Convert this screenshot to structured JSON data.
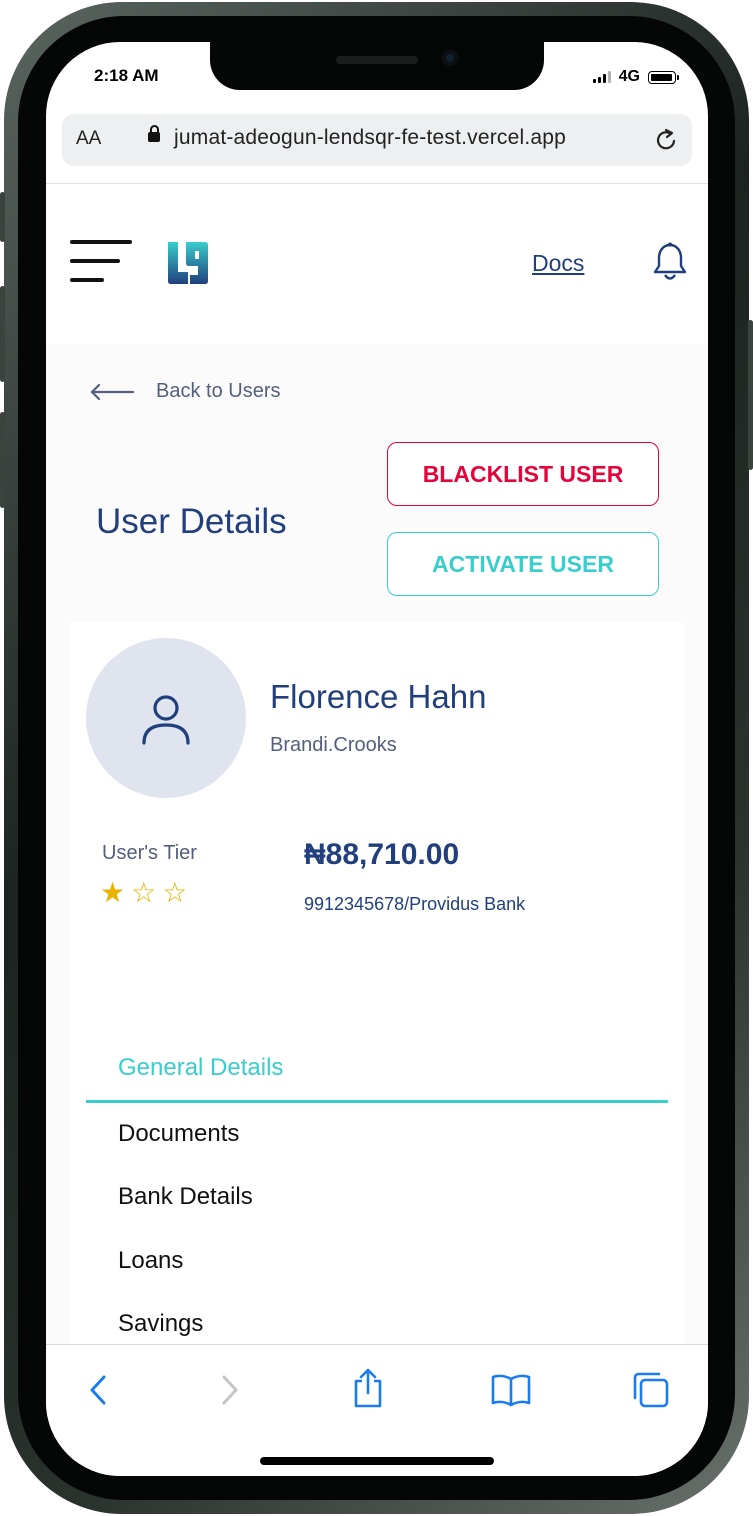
{
  "status_bar": {
    "time": "2:18 AM",
    "network": "4G"
  },
  "browser": {
    "text_size_label": "AA",
    "url": "jumat-adeogun-lendsqr-fe-test.vercel.app"
  },
  "header": {
    "docs_link": "Docs"
  },
  "back_link": "Back to Users",
  "page_title": "User Details",
  "actions": {
    "blacklist": "BLACKLIST USER",
    "activate": "ACTIVATE USER"
  },
  "profile": {
    "full_name": "Florence Hahn",
    "username": "Brandi.Crooks",
    "tier_label": "User's Tier",
    "tier_stars_filled": 1,
    "tier_stars_total": 3,
    "balance": "₦88,710.00",
    "account": "9912345678/Providus Bank"
  },
  "tabs": [
    "General Details",
    "Documents",
    "Bank Details",
    "Loans",
    "Savings"
  ],
  "colors": {
    "primary_navy": "#213F7D",
    "teal_accent": "#39CDCC",
    "danger_red": "#E4033B",
    "muted_text": "#545F7D",
    "star_gold": "#E9B200"
  }
}
